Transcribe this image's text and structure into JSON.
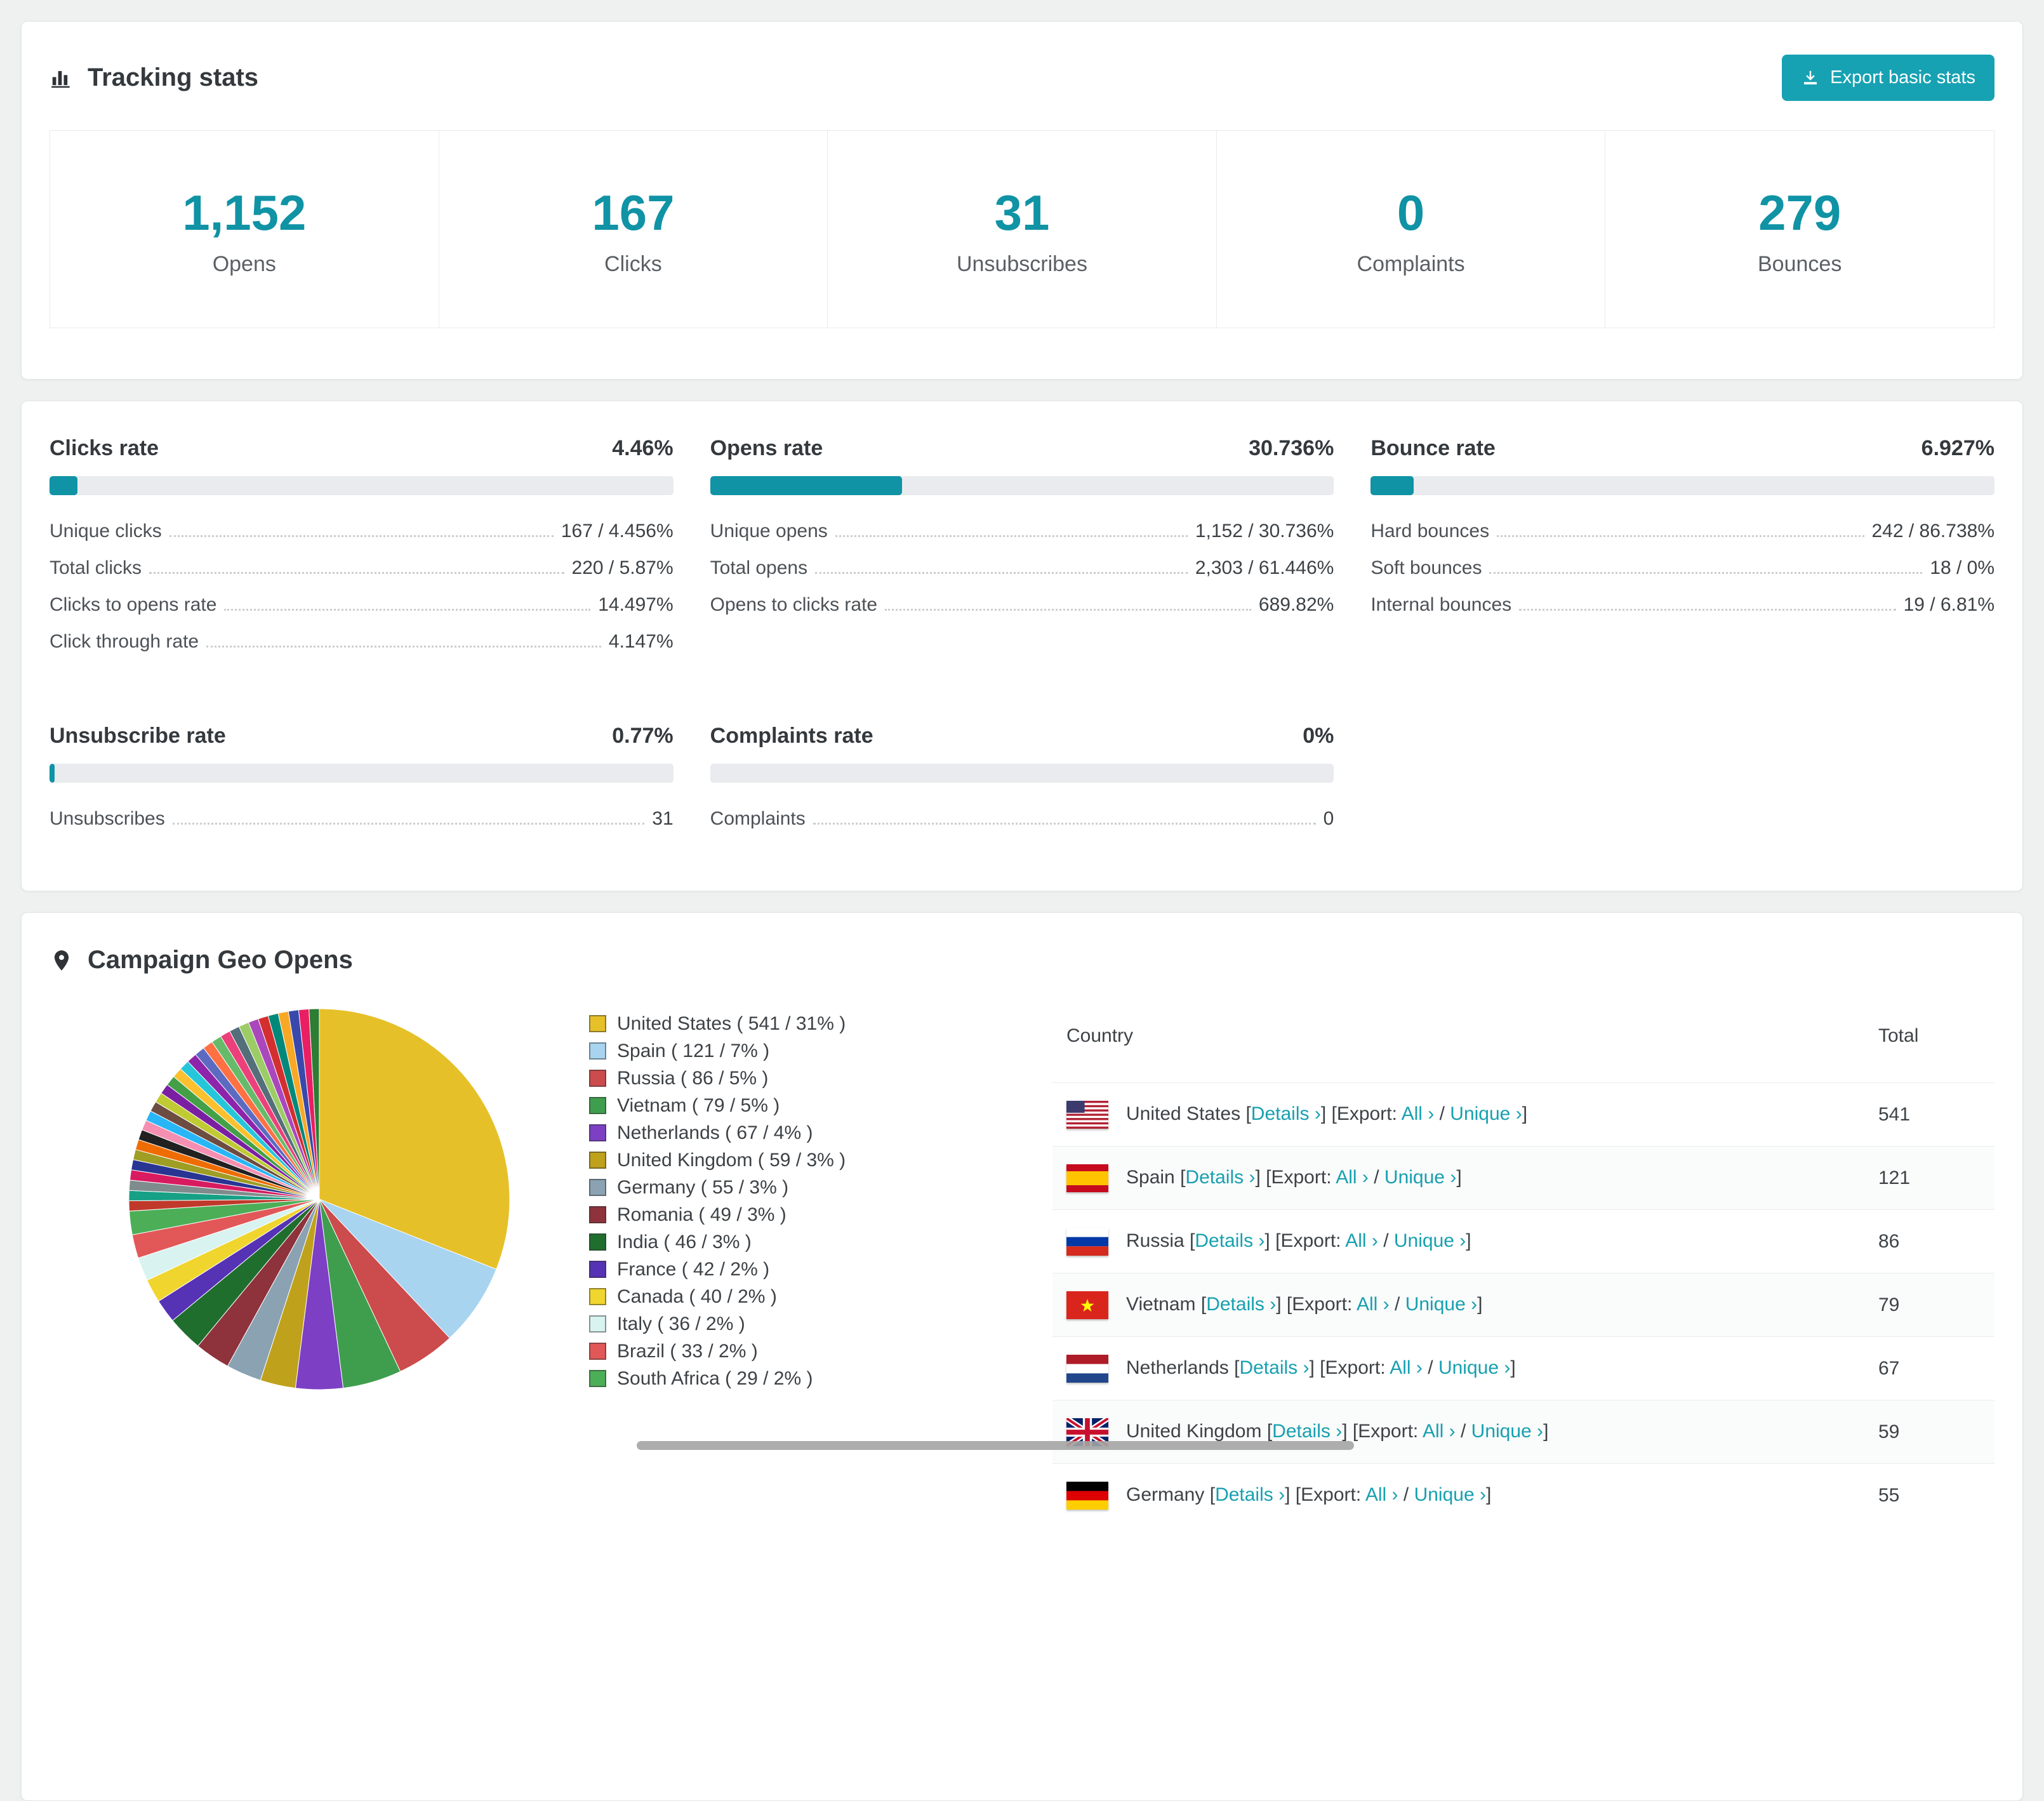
{
  "colors": {
    "accent": "#0f93a5",
    "button": "#17a2b3",
    "link": "#17a0b0",
    "bar_track": "#e9ebee"
  },
  "tracking": {
    "title": "Tracking stats",
    "export_label": "Export basic stats",
    "stats": [
      {
        "value": "1,152",
        "label": "Opens"
      },
      {
        "value": "167",
        "label": "Clicks"
      },
      {
        "value": "31",
        "label": "Unsubscribes"
      },
      {
        "value": "0",
        "label": "Complaints"
      },
      {
        "value": "279",
        "label": "Bounces"
      }
    ]
  },
  "rates": [
    {
      "title": "Clicks rate",
      "value": "4.46%",
      "percent": 4.46,
      "rows": [
        {
          "label": "Unique clicks",
          "value": "167 / 4.456%"
        },
        {
          "label": "Total clicks",
          "value": "220 / 5.87%"
        },
        {
          "label": "Clicks to opens rate",
          "value": "14.497%"
        },
        {
          "label": "Click through rate",
          "value": "4.147%"
        }
      ]
    },
    {
      "title": "Opens rate",
      "value": "30.736%",
      "percent": 30.736,
      "rows": [
        {
          "label": "Unique opens",
          "value": "1,152 / 30.736%"
        },
        {
          "label": "Total opens",
          "value": "2,303 / 61.446%"
        },
        {
          "label": "Opens to clicks rate",
          "value": "689.82%"
        }
      ]
    },
    {
      "title": "Bounce rate",
      "value": "6.927%",
      "percent": 6.927,
      "rows": [
        {
          "label": "Hard bounces",
          "value": "242 / 86.738%"
        },
        {
          "label": "Soft bounces",
          "value": "18 / 0%"
        },
        {
          "label": "Internal bounces",
          "value": "19 / 6.81%"
        }
      ]
    },
    {
      "title": "Unsubscribe rate",
      "value": "0.77%",
      "percent": 0.77,
      "rows": [
        {
          "label": "Unsubscribes",
          "value": "31"
        }
      ]
    },
    {
      "title": "Complaints rate",
      "value": "0%",
      "percent": 0,
      "rows": [
        {
          "label": "Complaints",
          "value": "0"
        }
      ]
    }
  ],
  "chart_data": {
    "type": "pie",
    "title": "Campaign Geo Opens",
    "unit": "opens",
    "legend_position": "right",
    "slices": [
      {
        "label": "United States",
        "value": 541,
        "pct": 31,
        "color": "#e6c029"
      },
      {
        "label": "Spain",
        "value": 121,
        "pct": 7,
        "color": "#a8d4f0"
      },
      {
        "label": "Russia",
        "value": 86,
        "pct": 5,
        "color": "#cc4b4c"
      },
      {
        "label": "Vietnam",
        "value": 79,
        "pct": 5,
        "color": "#3f9e4d"
      },
      {
        "label": "Netherlands",
        "value": 67,
        "pct": 4,
        "color": "#7d3fc4"
      },
      {
        "label": "United Kingdom",
        "value": 59,
        "pct": 3,
        "color": "#bfa11c"
      },
      {
        "label": "Germany",
        "value": 55,
        "pct": 3,
        "color": "#8aa2b2"
      },
      {
        "label": "Romania",
        "value": 49,
        "pct": 3,
        "color": "#8e323c"
      },
      {
        "label": "India",
        "value": 46,
        "pct": 3,
        "color": "#1f6e2e"
      },
      {
        "label": "France",
        "value": 42,
        "pct": 2,
        "color": "#5632b5"
      },
      {
        "label": "Canada",
        "value": 40,
        "pct": 2,
        "color": "#f0d52e"
      },
      {
        "label": "Italy",
        "value": 36,
        "pct": 2,
        "color": "#d8f3f0"
      },
      {
        "label": "Brazil",
        "value": 33,
        "pct": 2,
        "color": "#e25757"
      },
      {
        "label": "South Africa",
        "value": 29,
        "pct": 2,
        "color": "#4cae57"
      }
    ],
    "unlabeled_total_pct": 26,
    "unlabeled_slice_colors": [
      "#c0392b",
      "#16a085",
      "#7f8c8d",
      "#d81b60",
      "#283593",
      "#9e9d24",
      "#ef6c00",
      "#212121",
      "#f48fb1",
      "#29b6f6",
      "#6d4c41",
      "#c0ca33",
      "#7b1fa2",
      "#43a047",
      "#fbc02d",
      "#26c6da",
      "#8e24aa",
      "#5c6bc0",
      "#ff7043",
      "#66bb6a",
      "#ec407a",
      "#546e7a",
      "#9ccc65",
      "#ab47bc",
      "#d32f2f",
      "#00897b",
      "#f9a825",
      "#3949ab",
      "#e91e63",
      "#2e7d32"
    ]
  },
  "geo": {
    "title": "Campaign Geo Opens",
    "table": {
      "country_header": "Country",
      "total_header": "Total",
      "details_label": "Details ›",
      "export_label": "Export:",
      "all_label": "All ›",
      "unique_label": "Unique ›",
      "rows": [
        {
          "country": "United States",
          "total": 541,
          "flag": "us"
        },
        {
          "country": "Spain",
          "total": 121,
          "flag": "es"
        },
        {
          "country": "Russia",
          "total": 86,
          "flag": "ru"
        },
        {
          "country": "Vietnam",
          "total": 79,
          "flag": "vn"
        },
        {
          "country": "Netherlands",
          "total": 67,
          "flag": "nl"
        },
        {
          "country": "United Kingdom",
          "total": 59,
          "flag": "gb"
        },
        {
          "country": "Germany",
          "total": 55,
          "flag": "de"
        }
      ]
    }
  }
}
